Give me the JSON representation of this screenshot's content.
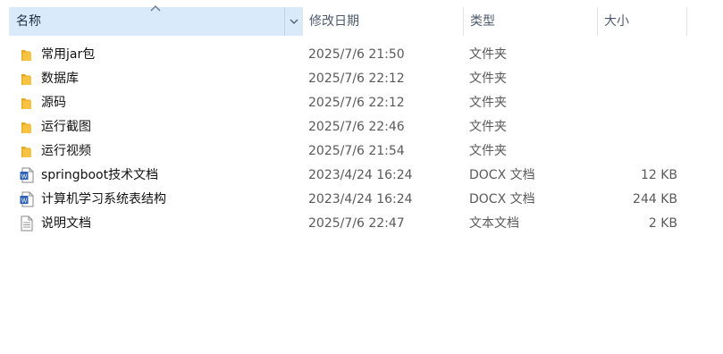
{
  "columns": {
    "name": "名称",
    "date": "修改日期",
    "type": "类型",
    "size": "大小"
  },
  "files": [
    {
      "name": "常用jar包",
      "date": "2025/7/6 21:50",
      "type": "文件夹",
      "size": "",
      "icon": "folder-icon"
    },
    {
      "name": "数据库",
      "date": "2025/7/6 22:12",
      "type": "文件夹",
      "size": "",
      "icon": "folder-icon"
    },
    {
      "name": "源码",
      "date": "2025/7/6 22:12",
      "type": "文件夹",
      "size": "",
      "icon": "folder-icon"
    },
    {
      "name": "运行截图",
      "date": "2025/7/6 22:46",
      "type": "文件夹",
      "size": "",
      "icon": "folder-icon"
    },
    {
      "name": "运行视频",
      "date": "2025/7/6 21:54",
      "type": "文件夹",
      "size": "",
      "icon": "folder-icon"
    },
    {
      "name": "springboot技术文档",
      "date": "2023/4/24 16:24",
      "type": "DOCX 文档",
      "size": "12 KB",
      "icon": "word-document-icon"
    },
    {
      "name": "计算机学习系统表结构",
      "date": "2023/4/24 16:24",
      "type": "DOCX 文档",
      "size": "244 KB",
      "icon": "word-document-icon"
    },
    {
      "name": "说明文档",
      "date": "2025/7/6 22:47",
      "type": "文本文档",
      "size": "2 KB",
      "icon": "text-document-icon"
    }
  ],
  "colors": {
    "folder": "#f8c342",
    "word": "#2b5fb3",
    "header_selected": "#d9ebfa"
  }
}
